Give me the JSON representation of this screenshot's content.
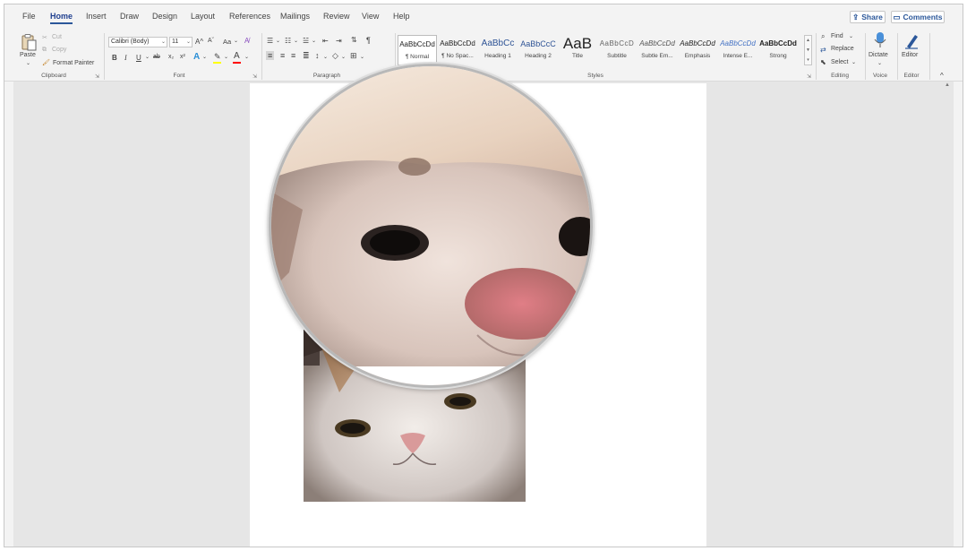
{
  "menu": {
    "tabs": [
      "File",
      "Home",
      "Insert",
      "Draw",
      "Design",
      "Layout",
      "References",
      "Mailings",
      "Review",
      "View",
      "Help"
    ],
    "active_tab": "Home",
    "share_label": "Share",
    "comments_label": "Comments"
  },
  "clipboard": {
    "paste": "Paste",
    "cut": "Cut",
    "copy": "Copy",
    "format_painter": "Format Painter",
    "label": "Clipboard"
  },
  "font": {
    "family": "Calibri (Body)",
    "size": "11",
    "grow": "A^",
    "shrink": "Aˇ",
    "case": "Aa",
    "bold": "B",
    "italic": "I",
    "underline": "U",
    "strike": "ab",
    "subscript": "x₂",
    "superscript": "x²",
    "label": "Font",
    "highlight_color": "#ffff00",
    "font_color": "#ff0000"
  },
  "paragraph": {
    "label": "Paragraph"
  },
  "styles": {
    "items": [
      {
        "sample": "AaBbCcDd",
        "name": "¶ Normal"
      },
      {
        "sample": "AaBbCcDd",
        "name": "¶ No Spac..."
      },
      {
        "sample": "AaBbCc",
        "name": "Heading 1"
      },
      {
        "sample": "AaBbCcC",
        "name": "Heading 2"
      },
      {
        "sample": "AaB",
        "name": "Title"
      },
      {
        "sample": "AaBbCcD",
        "name": "Subtitle"
      },
      {
        "sample": "AaBbCcDd",
        "name": "Subtle Em..."
      },
      {
        "sample": "AaBbCcDd",
        "name": "Emphasis"
      },
      {
        "sample": "AaBbCcDd",
        "name": "Intense E..."
      },
      {
        "sample": "AaBbCcDd",
        "name": "Strong"
      }
    ],
    "label": "Styles"
  },
  "editing": {
    "find": "Find",
    "replace": "Replace",
    "select": "Select",
    "label": "Editing"
  },
  "voice": {
    "dictate": "Dictate",
    "label": "Voice"
  },
  "editor_group": {
    "editor": "Editor",
    "label": "Editor"
  },
  "colors": {
    "accent": "#2b579a",
    "heading_blue": "#2f5496"
  }
}
